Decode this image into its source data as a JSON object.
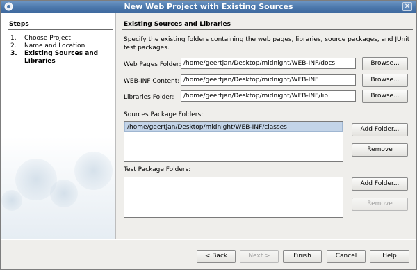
{
  "window": {
    "title": "New Web Project with Existing Sources",
    "close_glyph": "✕"
  },
  "steps": {
    "title": "Steps",
    "items": [
      {
        "num": "1.",
        "label": "Choose Project"
      },
      {
        "num": "2.",
        "label": "Name and Location"
      },
      {
        "num": "3.",
        "label": "Existing Sources and Libraries"
      }
    ]
  },
  "main": {
    "title": "Existing Sources and Libraries",
    "description": "Specify the existing folders containing the web pages, libraries, source packages, and JUnit test packages.",
    "web_pages": {
      "label": "Web Pages Folder:",
      "value": "/home/geertjan/Desktop/midnight/WEB-INF/docs",
      "button": "Browse..."
    },
    "web_inf": {
      "label": "WEB-INF Content:",
      "value": "/home/geertjan/Desktop/midnight/WEB-INF",
      "button": "Browse..."
    },
    "libraries": {
      "label": "Libraries Folder:",
      "value": "/home/geertjan/Desktop/midnight/WEB-INF/lib",
      "button": "Browse..."
    },
    "sources": {
      "label": "Sources Package Folders:",
      "items": [
        "/home/geertjan/Desktop/midnight/WEB-INF/classes"
      ],
      "add_button": "Add Folder...",
      "remove_button": "Remove"
    },
    "tests": {
      "label": "Test Package Folders:",
      "items": [],
      "add_button": "Add Folder...",
      "remove_button": "Remove"
    }
  },
  "footer": {
    "back": "< Back",
    "next": "Next >",
    "finish": "Finish",
    "cancel": "Cancel",
    "help": "Help"
  },
  "colors": {
    "titlebar": "#4c78ac",
    "selection": "#c3d4e8"
  }
}
